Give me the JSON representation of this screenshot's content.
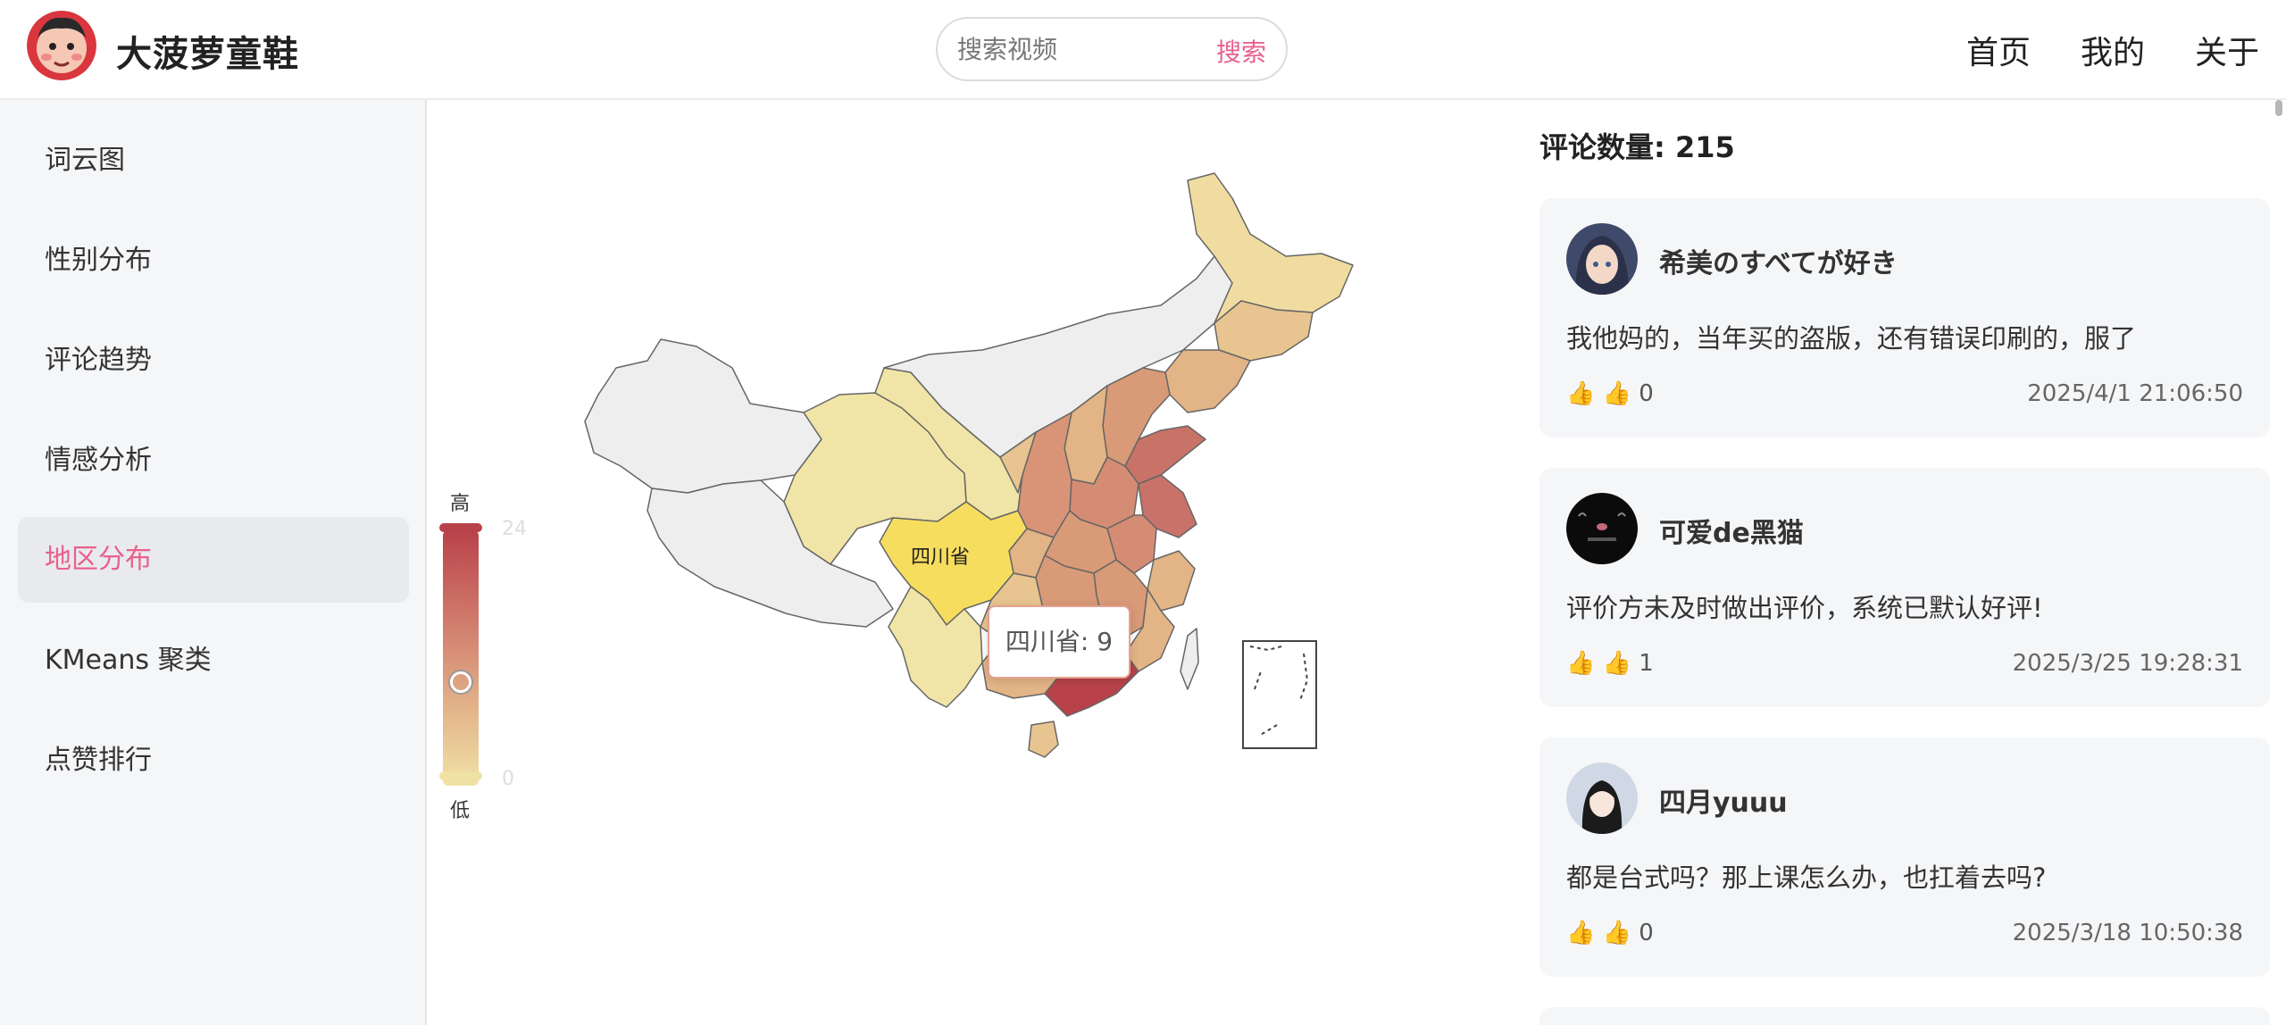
{
  "header": {
    "site_title": "大菠萝童鞋",
    "search_placeholder": "搜索视频",
    "search_button": "搜索",
    "nav": [
      "首页",
      "我的",
      "关于"
    ]
  },
  "sidebar": {
    "items": [
      {
        "label": "词云图"
      },
      {
        "label": "性别分布"
      },
      {
        "label": "评论趋势"
      },
      {
        "label": "情感分析"
      },
      {
        "label": "地区分布",
        "active": true
      },
      {
        "label": "KMeans 聚类"
      },
      {
        "label": "点赞排行"
      }
    ]
  },
  "map": {
    "legend_high": "高",
    "legend_low": "低",
    "legend_max": "24",
    "legend_min": "0",
    "highlight_label": "四川省",
    "tooltip": "四川省: 9",
    "colors": {
      "high": "#b9424a",
      "mid": "#e0ac86",
      "low": "#f0e2a5",
      "none": "#eeeeee",
      "highlight": "#f7dd5e"
    }
  },
  "comments": {
    "count_label": "评论数量: 215",
    "items": [
      {
        "user": "希美のすべてが好き",
        "text": "我他妈的，当年买的盗版，还有错误印刷的，服了",
        "likes": "👍 👍 0",
        "date": "2025/4/1 21:06:50"
      },
      {
        "user": "可爱de黑猫",
        "text": "评价方未及时做出评价，系统已默认好评!",
        "likes": "👍 👍 1",
        "date": "2025/3/25 19:28:31"
      },
      {
        "user": "四月yuuu",
        "text": "都是台式吗？那上课怎么办，也扛着去吗?",
        "likes": "👍 👍 0",
        "date": "2025/3/18 10:50:38"
      }
    ]
  }
}
